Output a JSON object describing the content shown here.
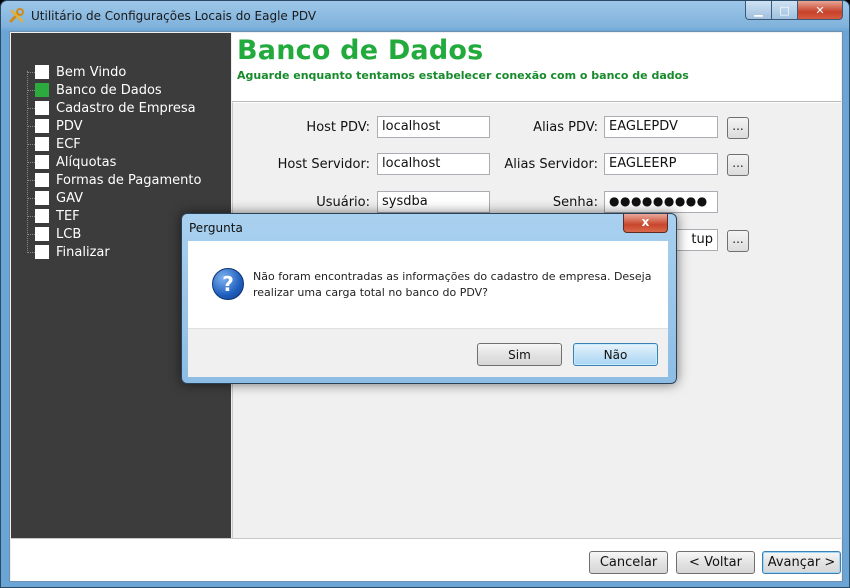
{
  "window": {
    "title": "Utilitário de Configurações Locais do Eagle PDV",
    "min_glyph": "▁",
    "max_glyph": "□",
    "close_glyph": "✕"
  },
  "sidebar": {
    "items": [
      {
        "label": "Bem Vindo",
        "active": false
      },
      {
        "label": "Banco de Dados",
        "active": true
      },
      {
        "label": "Cadastro de Empresa",
        "active": false
      },
      {
        "label": "PDV",
        "active": false
      },
      {
        "label": "ECF",
        "active": false
      },
      {
        "label": "Alíquotas",
        "active": false
      },
      {
        "label": "Formas de Pagamento",
        "active": false
      },
      {
        "label": "GAV",
        "active": false
      },
      {
        "label": "TEF",
        "active": false
      },
      {
        "label": "LCB",
        "active": false
      },
      {
        "label": "Finalizar",
        "active": false
      }
    ]
  },
  "header": {
    "title": "Banco de Dados",
    "subtitle": "Aguarde enquanto tentamos estabelecer conexão com o banco de dados"
  },
  "form": {
    "host_pdv_label": "Host PDV:",
    "host_pdv_value": "localhost",
    "alias_pdv_label": "Alias PDV:",
    "alias_pdv_value": "EAGLEPDV",
    "host_servidor_label": "Host Servidor:",
    "host_servidor_value": "localhost",
    "alias_servidor_label": "Alias Servidor:",
    "alias_servidor_value": "EAGLEERP",
    "usuario_label": "Usuário:",
    "usuario_value": "sysdba",
    "senha_label": "Senha:",
    "senha_value": "●●●●●●●●●",
    "backup_partial_value": "tup",
    "browse_label": "..."
  },
  "footer": {
    "cancel_label": "Cancelar",
    "back_label": "< Voltar",
    "next_label": "Avançar >"
  },
  "dialog": {
    "title": "Pergunta",
    "close_glyph": "x",
    "icon_glyph": "?",
    "message": "Não foram encontradas as informações do cadastro de empresa. Deseja realizar uma carga total no banco do PDV?",
    "yes_label": "Sim",
    "no_label": "Não"
  },
  "colors": {
    "accent_green": "#22aa3c",
    "sidebar_bg": "#3c3c3c"
  }
}
